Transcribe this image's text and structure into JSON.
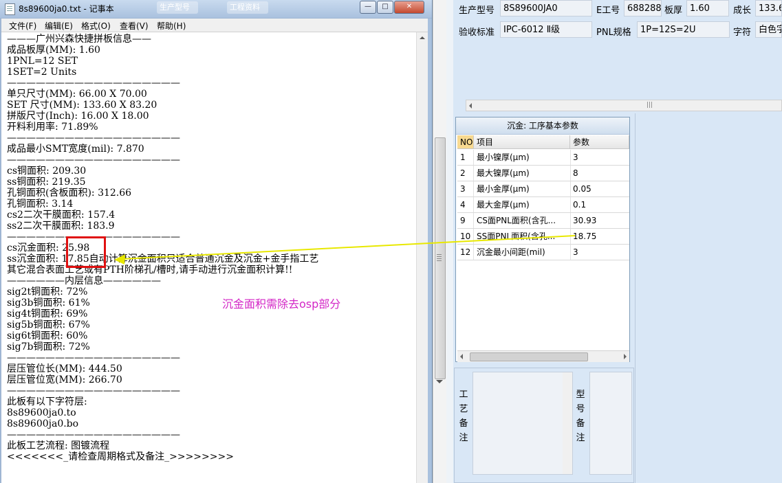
{
  "notepad": {
    "title": "8s89600ja0.txt - 记事本",
    "menu": [
      "文件(F)",
      "编辑(E)",
      "格式(O)",
      "查看(V)",
      "帮助(H)"
    ],
    "lines": [
      "———广州兴森快捷拼板信息——",
      "成品板厚(MM): 1.60",
      "1PNL=12 SET",
      "1SET=2 Units",
      "——————————————————",
      "单只尺寸(MM): 66.00 X 70.00",
      "SET 尺寸(MM): 133.60 X 83.20",
      "拼版尺寸(Inch): 16.00 X 18.00",
      "开料利用率: 71.89%",
      "——————————————————",
      "成品最小SMT宽度(mil): 7.870",
      "——————————————————",
      "cs铜面积: 209.30",
      "ss铜面积: 219.35",
      "孔铜面积(含板面积): 312.66",
      "孔铜面积: 3.14",
      "cs2二次干膜面积: 157.4",
      "ss2二次干膜面积: 183.9",
      "——————————————————",
      "cs沉金面积: 25.98",
      "ss沉金面积: 17.85自动计算沉金面积只适合普通沉金及沉金+金手指工艺",
      "其它混合表面工艺或有PTH阶梯孔/槽时,请手动进行沉金面积计算!!",
      "——————内层信息——————",
      "sig2t铜面积: 72%",
      "sig3b铜面积: 61%",
      "sig4t铜面积: 69%",
      "sig5b铜面积: 67%",
      "sig6t铜面积: 60%",
      "sig7b铜面积: 72%",
      "——————————————————",
      "层压管位长(MM): 444.50",
      "层压管位宽(MM): 266.70",
      "——————————————————",
      "此板有以下字符层:",
      "8s89600ja0.to",
      "8s89600ja0.bo",
      "——————————————————",
      "此板工艺流程: 图镀流程",
      "<<<<<<<_请检查周期格式及备注_>>>>>>>>"
    ]
  },
  "taskbar_ghost": [
    "生产型号",
    "工程资料"
  ],
  "form": {
    "model_label": "生产型号",
    "model_value": "8S89600JA0",
    "eno_label": "E工号",
    "eno_value": "688288",
    "thickness_label": "板厚",
    "thickness_value": "1.60",
    "length_label": "成长",
    "length_value": "133.6",
    "standard_label": "验收标准",
    "standard_value": "IPC-6012 Ⅱ级",
    "pnl_label": "PNL规格",
    "pnl_value": "1P=12S=2U",
    "char_label": "字符",
    "char_value": "白色字"
  },
  "grid": {
    "title": "沉金: 工序基本参数",
    "headers": [
      "NO",
      "项目",
      "参数"
    ],
    "rows": [
      {
        "no": "1",
        "item": "最小镍厚(μm)",
        "value": "3"
      },
      {
        "no": "2",
        "item": "最大镍厚(μm)",
        "value": "8"
      },
      {
        "no": "3",
        "item": "最小金厚(μm)",
        "value": "0.05"
      },
      {
        "no": "4",
        "item": "最大金厚(μm)",
        "value": "0.1"
      },
      {
        "no": "9",
        "item": "CS面PNL面积(含孔...",
        "value": "30.93"
      },
      {
        "no": "10",
        "item": "SS面PNL面积(含孔...",
        "value": "18.75"
      },
      {
        "no": "12",
        "item": "沉金最小间距(mil)",
        "value": "3"
      }
    ]
  },
  "notes": {
    "process_label": "工艺备注",
    "model_label": "型号备注"
  },
  "annotation": {
    "text": "沉金面积需除去osp部分",
    "arrow_color": "#e8e800",
    "box_color": "#e01010",
    "text_color": "#d326c6"
  }
}
